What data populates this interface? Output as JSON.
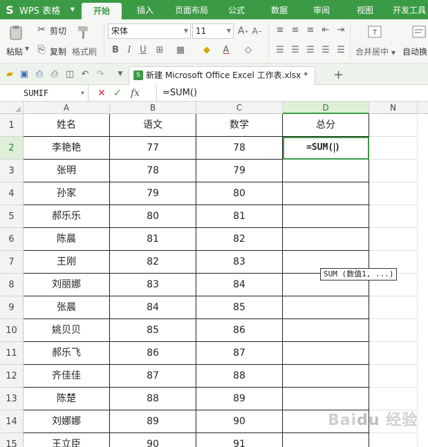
{
  "app": {
    "name": "WPS 表格"
  },
  "menu_tabs": [
    "开始",
    "插入",
    "页面布局",
    "公式",
    "数据",
    "审阅",
    "视图",
    "开发工具"
  ],
  "active_menu_tab": "开始",
  "ribbon": {
    "paste": "粘贴",
    "cut": "剪切",
    "copy": "复制",
    "format_painter": "格式刷",
    "font_name": "宋体",
    "font_size": "11",
    "merge_center": "合并居中",
    "wrap": "自动换"
  },
  "document_tab": {
    "title": "新建 Microsoft Office Excel 工作表.xlsx *"
  },
  "formula_bar": {
    "name_box": "SUMIF",
    "formula": "=SUM()"
  },
  "columns": [
    "A",
    "B",
    "C",
    "D",
    "N"
  ],
  "selected_column": "D",
  "header_row": {
    "name": "姓名",
    "chinese": "语文",
    "math": "数学",
    "total": "总分"
  },
  "rows": [
    {
      "num": "2",
      "name": "李艳艳",
      "chinese": "77",
      "math": "78"
    },
    {
      "num": "3",
      "name": "张明",
      "chinese": "78",
      "math": "79"
    },
    {
      "num": "4",
      "name": "孙家",
      "chinese": "79",
      "math": "80"
    },
    {
      "num": "5",
      "name": "郝乐乐",
      "chinese": "80",
      "math": "81"
    },
    {
      "num": "6",
      "name": "陈晨",
      "chinese": "81",
      "math": "82"
    },
    {
      "num": "7",
      "name": "王刚",
      "chinese": "82",
      "math": "83"
    },
    {
      "num": "8",
      "name": "刘丽娜",
      "chinese": "83",
      "math": "84"
    },
    {
      "num": "9",
      "name": "张晨",
      "chinese": "84",
      "math": "85"
    },
    {
      "num": "10",
      "name": "姚贝贝",
      "chinese": "85",
      "math": "86"
    },
    {
      "num": "11",
      "name": "郝乐飞",
      "chinese": "86",
      "math": "87"
    },
    {
      "num": "12",
      "name": "齐佳佳",
      "chinese": "87",
      "math": "88"
    },
    {
      "num": "13",
      "name": "陈楚",
      "chinese": "88",
      "math": "89"
    },
    {
      "num": "14",
      "name": "刘娜娜",
      "chinese": "89",
      "math": "90"
    },
    {
      "num": "15",
      "name": "王立臣",
      "chinese": "90",
      "math": "91"
    }
  ],
  "active_cell": {
    "ref": "D2",
    "content": "=SUM("
  },
  "tooltip": "SUM (数值1, ...)",
  "watermark": "Baidu经验",
  "colors": {
    "wps_green": "#3b9b45",
    "ribbon_bg": "#f4f7f3"
  }
}
